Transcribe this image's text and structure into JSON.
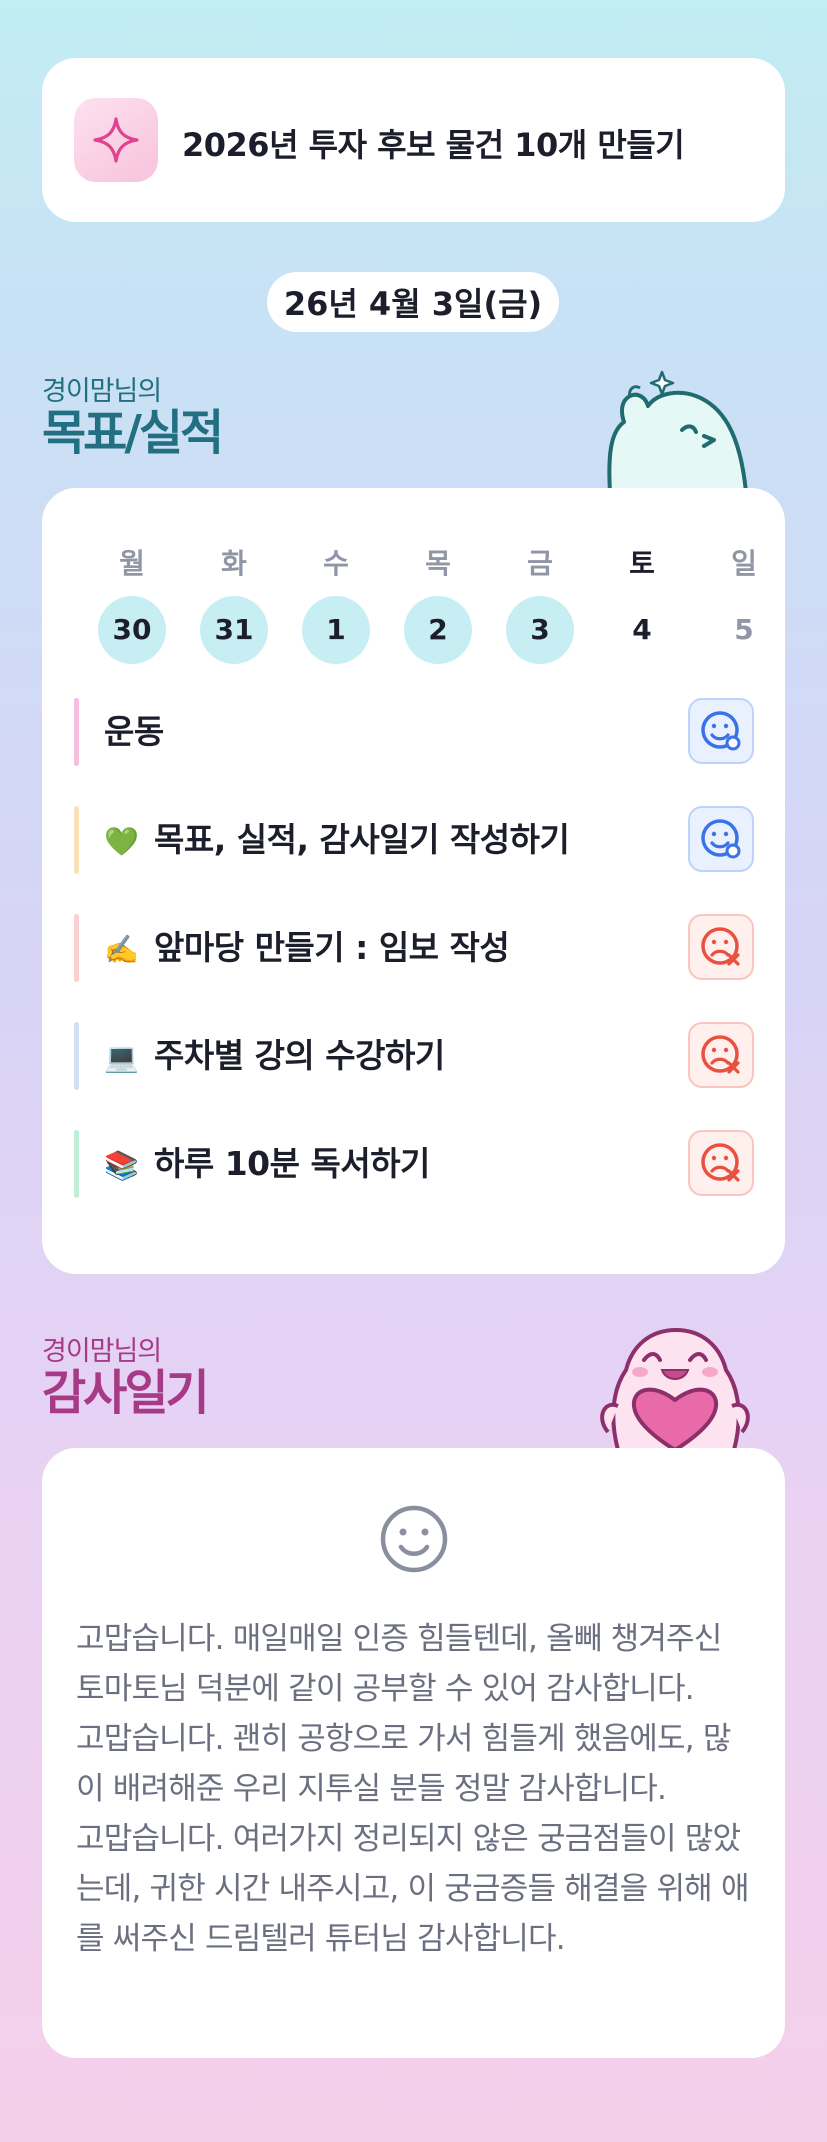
{
  "goal": {
    "title": "2026년 투자 후보 물건 10개 만들기",
    "icon": "sparkle-icon"
  },
  "date_label": "26년 4월 3일(금)",
  "goals_section": {
    "small": "경이맘님의",
    "big": "목표/실적"
  },
  "week": {
    "day_names": [
      "월",
      "화",
      "수",
      "목",
      "금",
      "토",
      "일"
    ],
    "day_numbers": [
      "30",
      "31",
      "1",
      "2",
      "3",
      "4",
      "5"
    ],
    "day_states": [
      "done",
      "done",
      "done",
      "done",
      "done",
      "today",
      "future"
    ]
  },
  "tasks": [
    {
      "emoji": "",
      "label": "운동",
      "status": "done",
      "bar_color": "#f6bfe0"
    },
    {
      "emoji": "💚",
      "label": "목표, 실적, 감사일기 작성하기",
      "status": "done",
      "bar_color": "#fbe1b8"
    },
    {
      "emoji": "✍️",
      "label": "앞마당 만들기 : 임보 작성",
      "status": "not-done",
      "bar_color": "#fbd0d0"
    },
    {
      "emoji": "💻",
      "label": "주차별 강의 수강하기",
      "status": "not-done",
      "bar_color": "#d3e1f6"
    },
    {
      "emoji": "📚",
      "label": "하루 10분 독서하기",
      "status": "not-done",
      "bar_color": "#bfeed9"
    }
  ],
  "diary_section": {
    "small": "경이맘님의",
    "big": "감사일기"
  },
  "diary": {
    "mood_icon": "smile-face-icon",
    "paragraphs": [
      "고맙습니다. 매일매일 인증 힘들텐데, 올빼 챙겨주신 토마토님 덕분에 같이 공부할 수 있어 감사합니다.",
      "고맙습니다. 괜히 공항으로 가서 힘들게 했음에도, 많이 배려해준 우리 지투실 분들 정말 감사합니다.",
      "고맙습니다. 여러가지 정리되지 않은 궁금점들이 많았는데, 귀한 시간 내주시고, 이 궁금증들 해결을 위해 애를 써주신 드림텔러 튜터님 감사합니다."
    ]
  },
  "colors": {
    "done_face": "#3a72e8",
    "bad_face": "#e8513f",
    "goals_label": "#236f82",
    "diary_label": "#a63a86"
  }
}
